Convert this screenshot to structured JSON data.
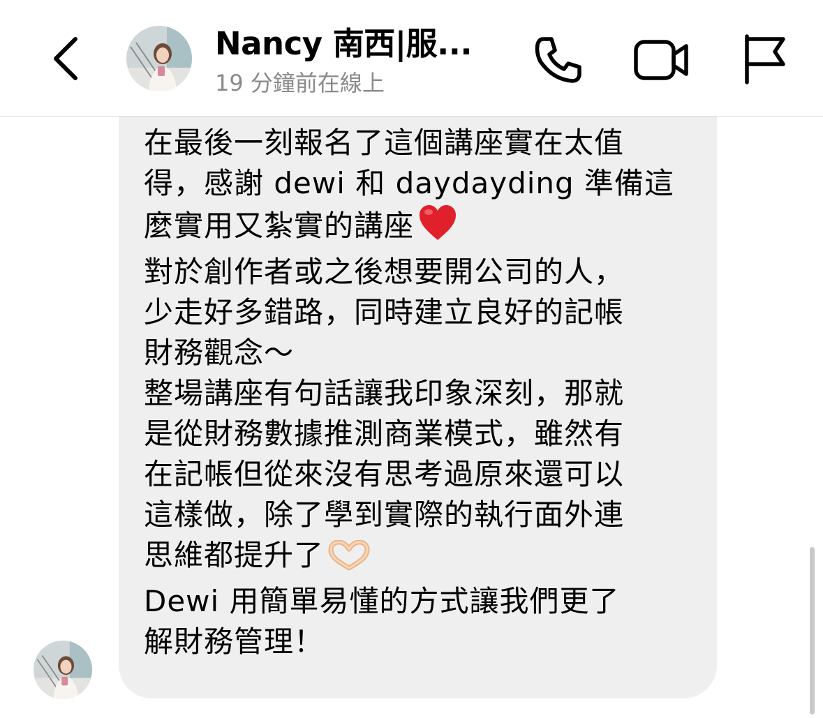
{
  "header": {
    "title": "Nancy 南西|服...",
    "status": "19 分鐘前在線上",
    "icons": {
      "back": "chevron-left-icon",
      "call": "phone-icon",
      "video": "video-camera-icon",
      "report": "flag-icon"
    }
  },
  "message": {
    "lines": [
      "在最後一刻報名了這個講座實在太值",
      "得，感謝 dewi 和 daydayding 準備這",
      "麼實用又紮實的講座",
      "對於創作者或之後想要開公司的人，",
      "少走好多錯路，同時建立良好的記帳",
      "財務觀念～",
      "整場講座有句話讓我印象深刻，那就",
      "是從財務數據推測商業模式，雖然有",
      "在記帳但從來沒有思考過原來還可以",
      "這樣做，除了學到實際的執行面外連",
      "思維都提升了",
      "Dewi 用簡單易懂的方式讓我們更了",
      "解財務管理！"
    ],
    "emojis": {
      "line3": "red-heart-icon",
      "line11": "heart-hands-icon"
    }
  },
  "colors": {
    "bubble": "#efefef",
    "subtitle": "#8a8a8a",
    "divider": "#dcdcdc",
    "heart": "#e0202b",
    "hands": "#f5c9a0"
  }
}
